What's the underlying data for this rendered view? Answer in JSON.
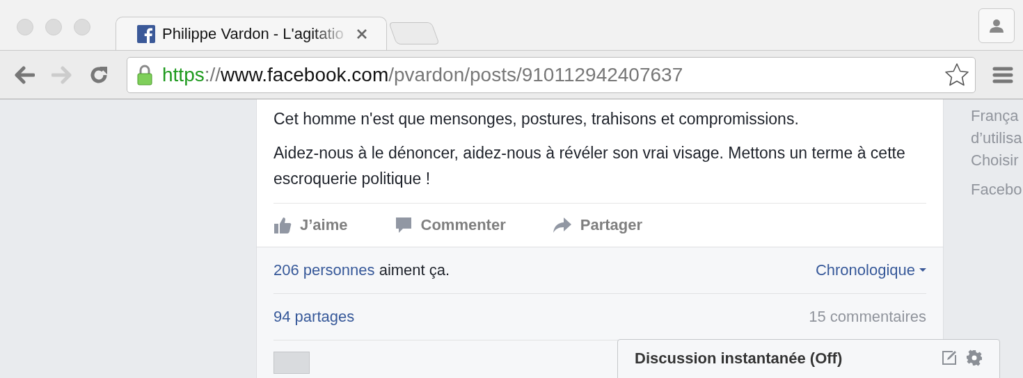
{
  "browser": {
    "tabs": [
      {
        "title": "Philippe Vardon - L'agitatio",
        "selected": true
      }
    ],
    "url": {
      "scheme": "https",
      "separator": "://",
      "host": "www.facebook.com",
      "path": "/pvardon/posts/910112942407637"
    }
  },
  "post": {
    "paragraphs": [
      "Cet homme n'est que mensonges, postures, trahisons et compromissions.",
      "Aidez-nous à le dénoncer, aidez-nous à révéler son vrai visage. Mettons un terme à cette escroquerie politique !"
    ],
    "actions": [
      {
        "kind": "like",
        "label": "J’aime"
      },
      {
        "kind": "comment",
        "label": "Commenter"
      },
      {
        "kind": "share",
        "label": "Partager"
      }
    ]
  },
  "summary": {
    "likes_link": "206 personnes",
    "likes_text": "aiment ça.",
    "sort": "Chronologique",
    "shares": "94 partages",
    "comments": "15 commentaires"
  },
  "sidebar": {
    "groups": [
      [
        "França",
        "d’utilisa",
        "Choisir"
      ],
      [
        "Facebo"
      ]
    ]
  },
  "chat": {
    "title": "Discussion instantanée (Off)"
  }
}
